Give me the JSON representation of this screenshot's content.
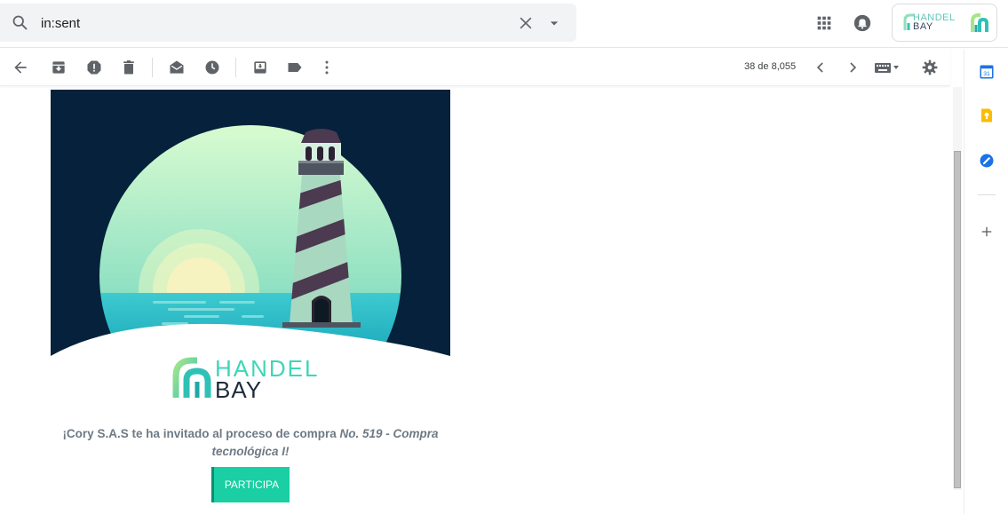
{
  "search": {
    "value": "in:sent",
    "placeholder": ""
  },
  "account": {
    "brand_line1": "HANDEL",
    "brand_line2": "BAY"
  },
  "pager": {
    "count_text": "38 de 8,055"
  },
  "email": {
    "brand_line1": "HANDEL",
    "brand_line2": "BAY",
    "invite_main": "¡Cory S.A.S te ha invitado al proceso de compra ",
    "invite_italic": "No. 519 - Compra tecnológica I!",
    "cta_label": "PARTICIPA"
  },
  "colors": {
    "brand_teal": "#19cfa3",
    "hero_background": "#06213b",
    "brand_dark": "#1e2b3a"
  },
  "icons": {
    "toolbar": [
      "back-arrow-icon",
      "archive-icon",
      "report-spam-icon",
      "delete-icon",
      "mark-unread-icon",
      "snooze-icon",
      "move-to-inbox-icon",
      "label-icon",
      "more-vert-icon"
    ],
    "pager": [
      "chevron-left-icon",
      "chevron-right-icon"
    ],
    "sidepanel": [
      "calendar-icon",
      "keep-icon",
      "tasks-icon",
      "add-icon"
    ]
  }
}
